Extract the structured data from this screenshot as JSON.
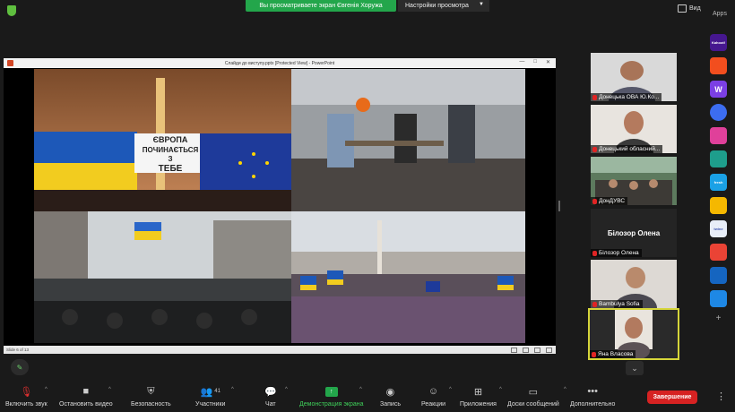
{
  "banner": {
    "sharing_text": "Вы просматриваете экран Євгенія Хоружа",
    "view_options": "Настройки просмотра"
  },
  "top_right": {
    "view_label": "Вид",
    "apps_label": "Apps"
  },
  "shared_window": {
    "title": "Слайди до виступу.pptx [Protected View] - PowerPoint",
    "status": "Slide 6 of 13",
    "slide_text": {
      "sign_line1": "ЄВРОПА",
      "sign_line2": "ПОЧИНАЄТЬСЯ",
      "sign_line3": "З",
      "sign_line4": "ТЕБЕ"
    }
  },
  "participants": [
    {
      "name": "Донецька ОВА Ю.Ко..."
    },
    {
      "name": "Донецький обласний..."
    },
    {
      "name": "ДонДУВС"
    },
    {
      "name": "Білозор Олена",
      "display": "Білозор Олена"
    },
    {
      "name": "Bambulya Sofia"
    },
    {
      "name": "Яна Власова"
    }
  ],
  "apps_rail": [
    {
      "label": "Kahoot!",
      "color": "#46178f"
    },
    {
      "label": "",
      "color": "#f24e1e"
    },
    {
      "label": "W",
      "color": "#7b3fe4"
    },
    {
      "label": "",
      "color": "#3c6df0"
    },
    {
      "label": "",
      "color": "#e0409a"
    },
    {
      "label": "",
      "color": "#1e9e8c"
    },
    {
      "label": "fresh",
      "color": "#1aa1e6"
    },
    {
      "label": "",
      "color": "#f5b800"
    },
    {
      "label": "twine",
      "color": "#e8eef8"
    },
    {
      "label": "",
      "color": "#ea4335"
    },
    {
      "label": "",
      "color": "#1565c0"
    },
    {
      "label": "",
      "color": "#1e88e5"
    }
  ],
  "toolbar": {
    "mute": "Включить звук",
    "video": "Остановить видео",
    "security": "Безопасность",
    "participants": "Участники",
    "participants_count": "41",
    "chat": "Чат",
    "share": "Демонстрация экрана",
    "record": "Запись",
    "reactions": "Реакции",
    "apps": "Приложения",
    "whiteboards": "Доски сообщений",
    "more": "Дополнительно",
    "end": "Завершение"
  },
  "colors": {
    "share_green": "#23a64b",
    "end_red": "#d62222",
    "active_speaker": "#d6d63a"
  }
}
